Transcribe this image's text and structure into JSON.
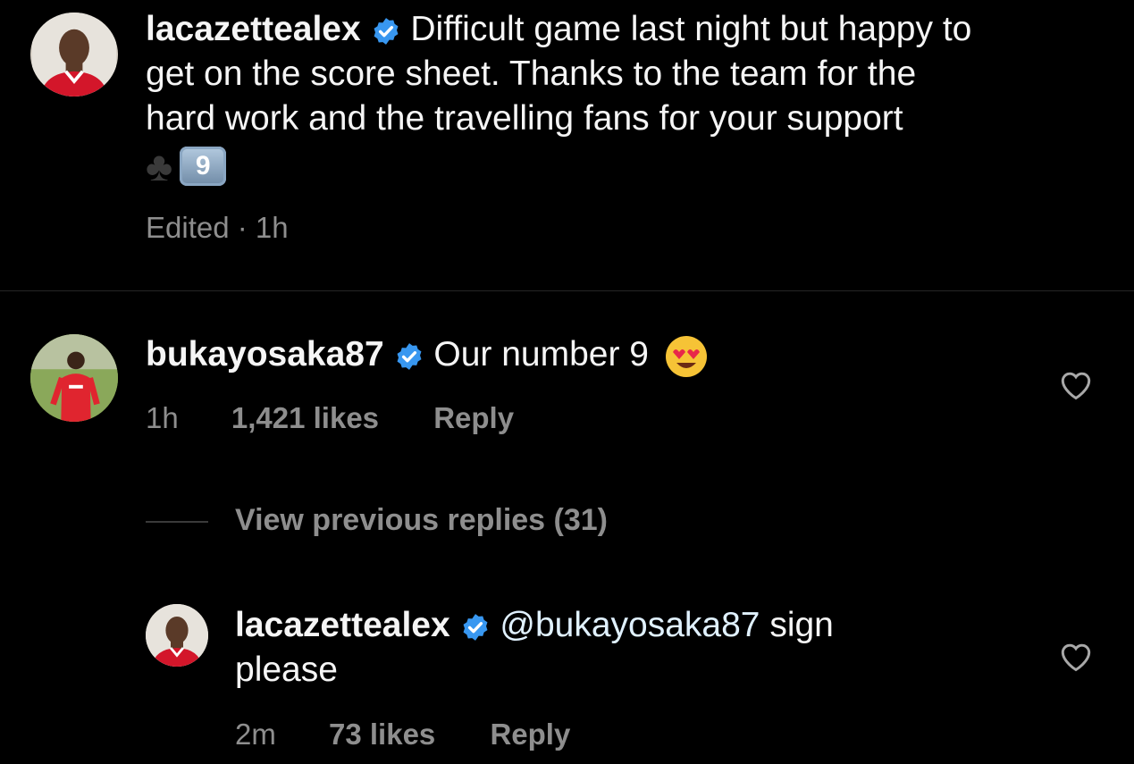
{
  "caption": {
    "username": "lacazettealex",
    "text_line1": "Difficult game last night but happy to",
    "text_line2": "get on the score sheet. Thanks to the team for the",
    "text_line3": "hard work and the travelling fans for your support",
    "emoji_club": "♣",
    "emoji_keycap": "9",
    "meta": "Edited · 1h"
  },
  "comment": {
    "username": "bukayosaka87",
    "text": "Our number 9",
    "time": "1h",
    "likes": "1,421 likes",
    "reply_label": "Reply"
  },
  "view_replies_label": "View previous replies (31)",
  "reply": {
    "username": "lacazettealex",
    "mention": "@bukayosaka87",
    "text_after_mention": " sign",
    "text_line2": "please",
    "time": "2m",
    "likes": "73 likes",
    "reply_label": "Reply"
  },
  "colors": {
    "background": "#000000",
    "verified_blue": "#3897f0",
    "muted_text": "#8e8e8e"
  }
}
